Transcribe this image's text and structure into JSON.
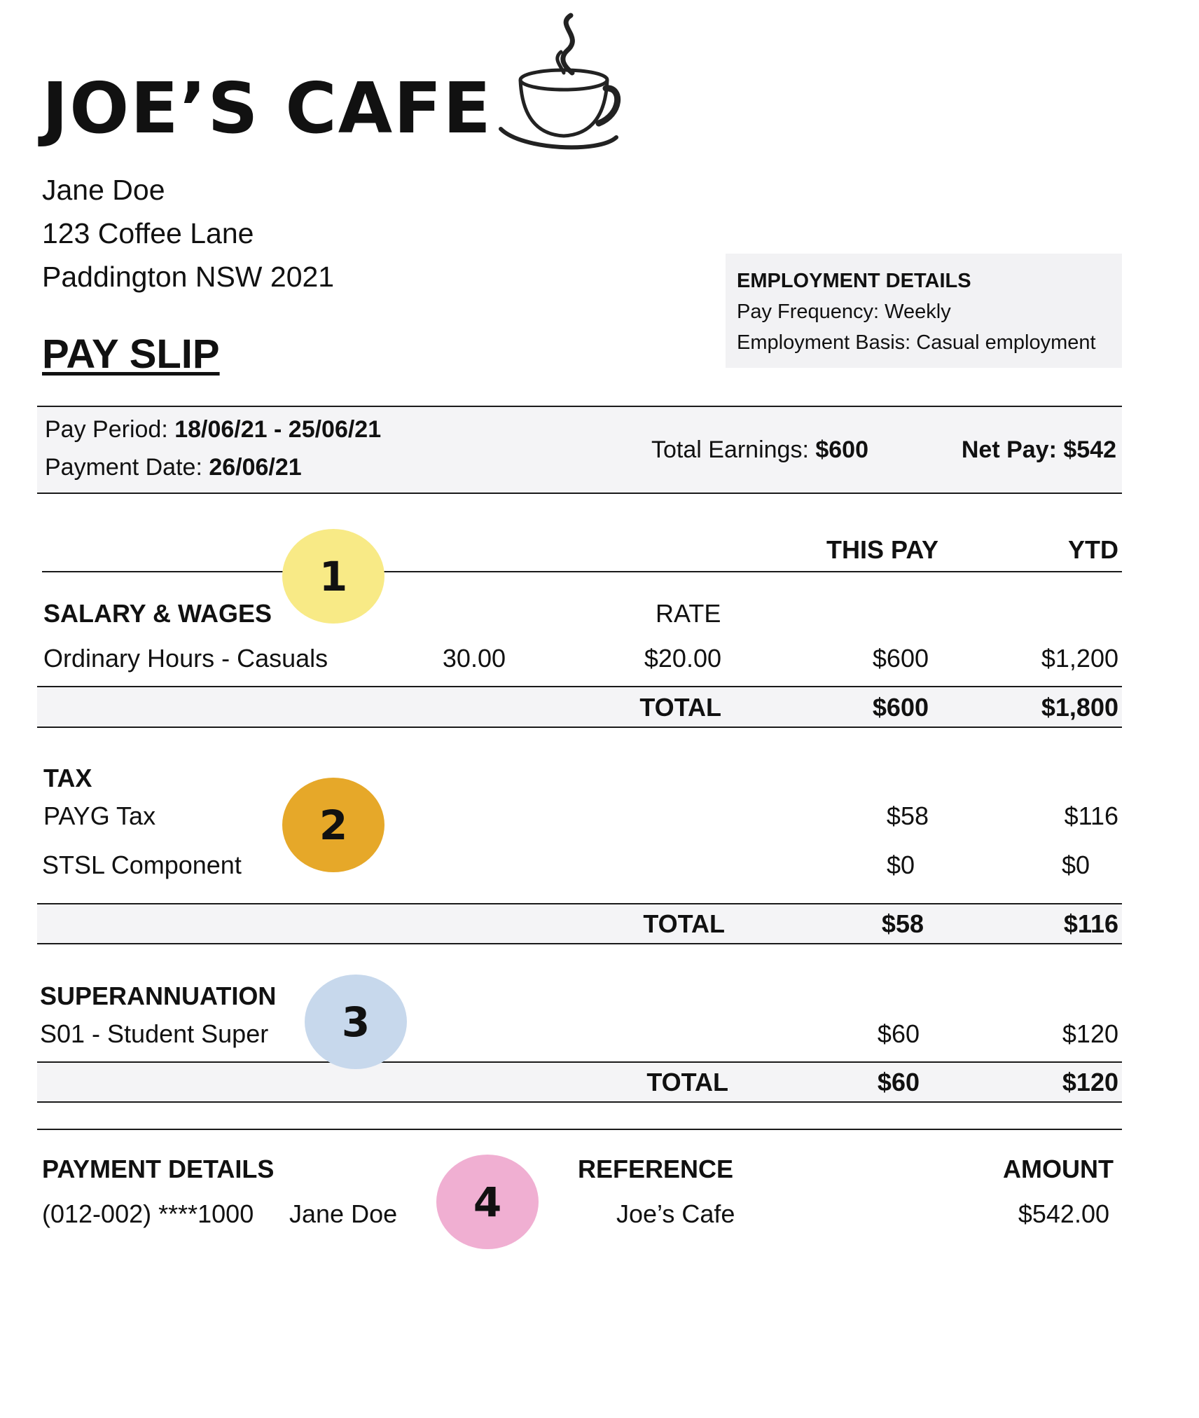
{
  "company": {
    "name": "JOE’S CAFE",
    "logo_icon": "coffee-cup-icon"
  },
  "employee": {
    "name": "Jane Doe",
    "address_line1": "123 Coffee Lane",
    "address_line2": "Paddington NSW 2021"
  },
  "title": "PAY SLIP",
  "employment": {
    "heading": "EMPLOYMENT DETAILS",
    "frequency": "Pay Frequency: Weekly",
    "basis": "Employment Basis: Casual employment"
  },
  "summary": {
    "pay_period_label": "Pay Period: ",
    "pay_period_value": "18/06/21 - 25/06/21",
    "payment_date_label": "Payment Date: ",
    "payment_date_value": "26/06/21",
    "total_earnings_label": "Total Earnings: ",
    "total_earnings_value": "$600",
    "net_pay": "Net Pay: $542"
  },
  "columns": {
    "this_pay": "THIS PAY",
    "ytd": "YTD"
  },
  "salary": {
    "heading": "SALARY & WAGES",
    "rate_header": "RATE",
    "item": {
      "label": "Ordinary Hours - Casuals",
      "hours": "30.00",
      "rate": "$20.00",
      "this_pay": "$600",
      "ytd": "$1,200"
    },
    "total": {
      "label": "TOTAL",
      "this_pay": "$600",
      "ytd": "$1,800"
    }
  },
  "tax": {
    "heading": "TAX",
    "items": [
      {
        "label": "PAYG Tax",
        "this_pay": "$58",
        "ytd": "$116"
      },
      {
        "label": "STSL Component",
        "this_pay": "$0",
        "ytd": "$0"
      }
    ],
    "total": {
      "label": "TOTAL",
      "this_pay": "$58",
      "ytd": "$116"
    }
  },
  "super": {
    "heading": "SUPERANNUATION",
    "item": {
      "label": "S01 - Student Super",
      "this_pay": "$60",
      "ytd": "$120"
    },
    "total": {
      "label": "TOTAL",
      "this_pay": "$60",
      "ytd": "$120"
    }
  },
  "payment": {
    "heading": "PAYMENT DETAILS",
    "reference_header": "REFERENCE",
    "amount_header": "AMOUNT",
    "account": "(012-002) ****1000",
    "account_name": "Jane Doe",
    "reference": "Joe’s Cafe",
    "amount": "$542.00"
  },
  "markers": [
    {
      "label": "1",
      "color": "#f8ea86"
    },
    {
      "label": "2",
      "color": "#e6a829"
    },
    {
      "label": "3",
      "color": "#c7d8ec"
    },
    {
      "label": "4",
      "color": "#f0afd2"
    }
  ]
}
